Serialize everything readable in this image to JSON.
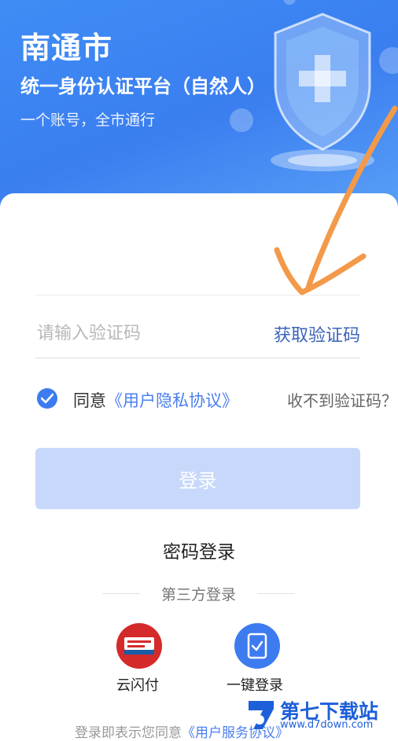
{
  "header": {
    "city": "南通市",
    "platform": "统一身份认证平台（自然人）",
    "slogan": "一个账号，全市通行"
  },
  "form": {
    "code_placeholder": "请输入验证码",
    "get_code_label": "获取验证码",
    "agree_prefix": "同意",
    "agree_link": "《用户隐私协议》",
    "no_code": "收不到验证码？",
    "login_label": "登录"
  },
  "alt_login": {
    "password_login": "密码登录",
    "third_party_title": "第三方登录",
    "options": [
      {
        "icon": "unionpay-icon",
        "label": "云闪付"
      },
      {
        "icon": "tablet-check-icon",
        "label": "一键登录"
      }
    ]
  },
  "footer": {
    "text": "登录即表示您同意",
    "link": "《用户服务协议》"
  },
  "watermark": {
    "title": "第七下载站",
    "url": "www.d7down.com"
  },
  "colors": {
    "hero_blue": "#3f8df5",
    "link_blue": "#4a7ff0",
    "button_disabled": "#c7d8fb",
    "annotation_orange": "#f39a4a"
  }
}
